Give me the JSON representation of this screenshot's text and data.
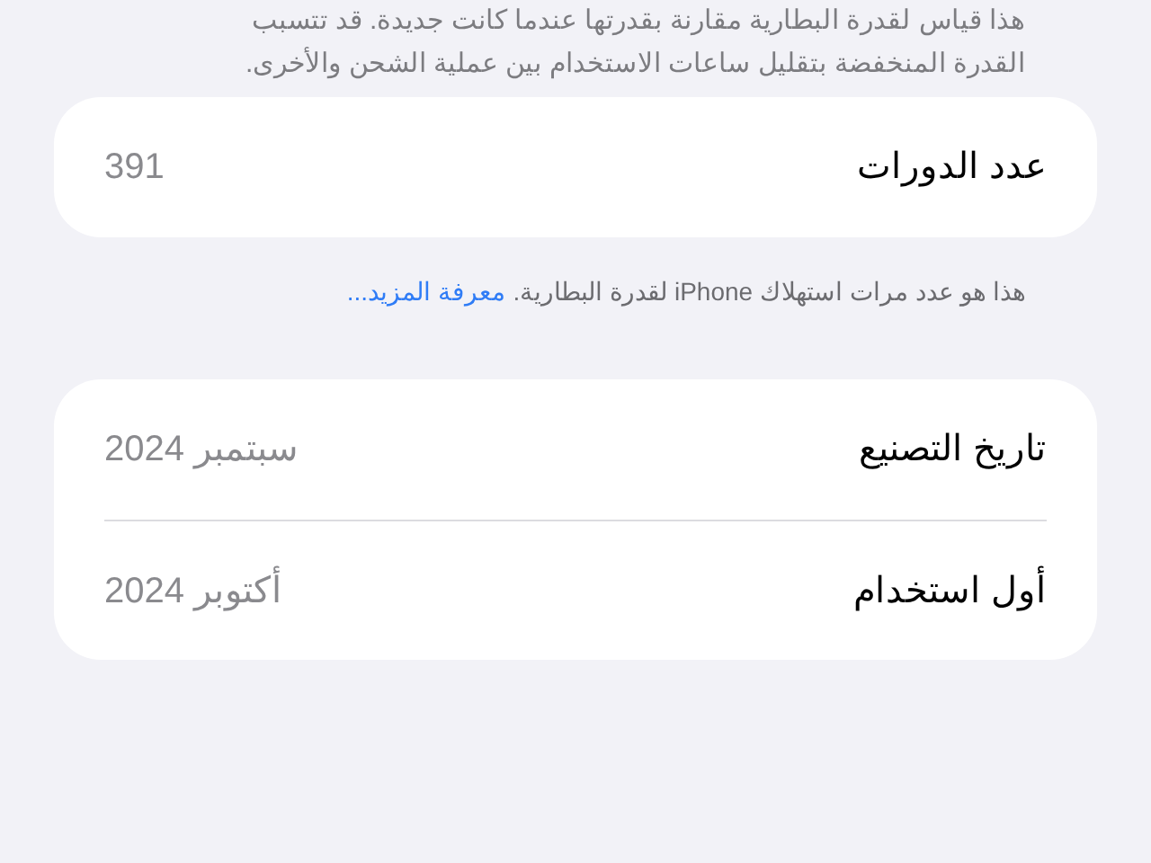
{
  "header_note": [
    "هذا قياس لقدرة البطارية مقارنة بقدرتها عندما كانت جديدة. قد تتسبب",
    "القدرة المنخفضة بتقليل ساعات الاستخدام بين عملية الشحن والأخرى."
  ],
  "cycle_card": {
    "rows": [
      {
        "label": "عدد الدورات",
        "value": "391"
      }
    ]
  },
  "cycle_note": {
    "text": "هذا هو عدد مرات استهلاك iPhone لقدرة البطارية.",
    "link": "معرفة المزيد..."
  },
  "dates_card": {
    "rows": [
      {
        "label": "تاريخ التصنيع",
        "value": "سبتمبر 2024"
      },
      {
        "label": "أول استخدام",
        "value": "أكتوبر 2024"
      }
    ]
  }
}
